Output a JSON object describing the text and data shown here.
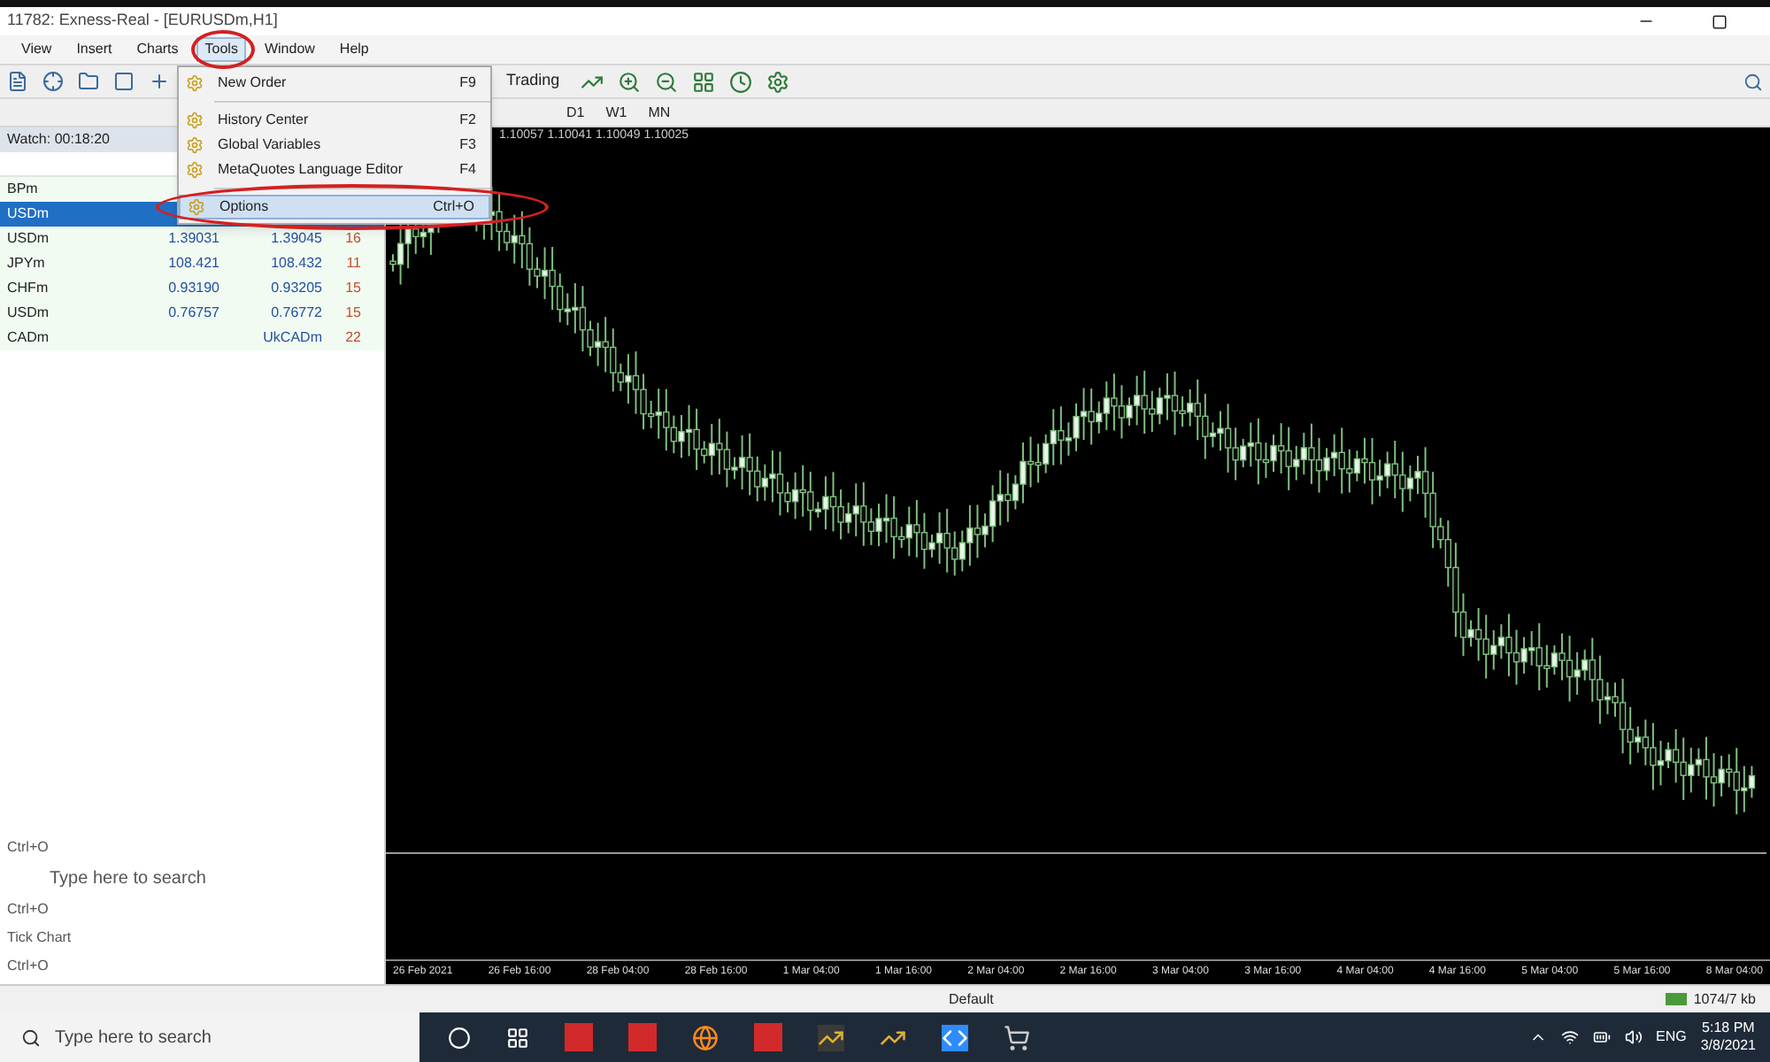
{
  "window": {
    "title": "11782: Exness-Real - [EURUSDm,H1]"
  },
  "menu_bar": [
    {
      "label": "View",
      "selected": false
    },
    {
      "label": "Insert",
      "selected": false
    },
    {
      "label": "Charts",
      "selected": false
    },
    {
      "label": "Tools",
      "selected": true
    },
    {
      "label": "Window",
      "selected": false
    },
    {
      "label": "Help",
      "selected": false
    }
  ],
  "tools_menu": [
    {
      "label": "New Order",
      "shortcut": "F9",
      "selected": false,
      "separator_after": true
    },
    {
      "label": "History Center",
      "shortcut": "F2",
      "selected": false,
      "separator_after": false
    },
    {
      "label": "Global Variables",
      "shortcut": "F3",
      "selected": false,
      "separator_after": false
    },
    {
      "label": "MetaQuotes Language Editor",
      "shortcut": "F4",
      "selected": false,
      "separator_after": true
    },
    {
      "label": "Options",
      "shortcut": "Ctrl+O",
      "selected": true,
      "separator_after": false
    }
  ],
  "toolbar": {
    "autotrading": "Trading",
    "timeframes": [
      "D1",
      "W1",
      "MN"
    ]
  },
  "market_watch": {
    "title": "Watch: 00:18:20",
    "rows": [
      {
        "symbol": "BPm",
        "selected": false
      },
      {
        "symbol": "USDm",
        "selected": true
      },
      {
        "symbol": "USDm",
        "bid": "1.39031",
        "ask": "1.39045",
        "spread": "16",
        "selected": false
      },
      {
        "symbol": "JPYm",
        "bid": "108.421",
        "ask": "108.432",
        "spread": "11",
        "selected": false
      },
      {
        "symbol": "CHFm",
        "bid": "0.93190",
        "ask": "0.93205",
        "spread": "15",
        "selected": false
      },
      {
        "symbol": "USDm",
        "bid": "0.76757",
        "ask": "0.76772",
        "spread": "15",
        "selected": false
      },
      {
        "symbol": "CADm",
        "ask": "UkCADm",
        "spread": "22",
        "selected": false
      }
    ]
  },
  "left_ghost_texts": [
    "Ctrl+O",
    "Type here to search",
    "Ctrl+O",
    "Tick Chart",
    "Ctrl+O"
  ],
  "chart": {
    "ohlc": "1.10057 1.10041 1.10049 1.10025",
    "time_labels": [
      "26 Feb 2021",
      "26 Feb 16:00",
      "28 Feb 04:00",
      "28 Feb 16:00",
      "1 Mar 04:00",
      "1 Mar 16:00",
      "2 Mar 04:00",
      "2 Mar 16:00",
      "3 Mar 04:00",
      "3 Mar 16:00",
      "4 Mar 04:00",
      "4 Mar 16:00",
      "5 Mar 04:00",
      "5 Mar 16:00",
      "8 Mar 04:00"
    ]
  },
  "status_bar": {
    "profile": "Default",
    "traffic": "1074/7 kb"
  },
  "taskbar": {
    "search_placeholder": "Type here to search",
    "language": "ENG",
    "time": "5:18 PM",
    "date": "3/8/2021"
  }
}
